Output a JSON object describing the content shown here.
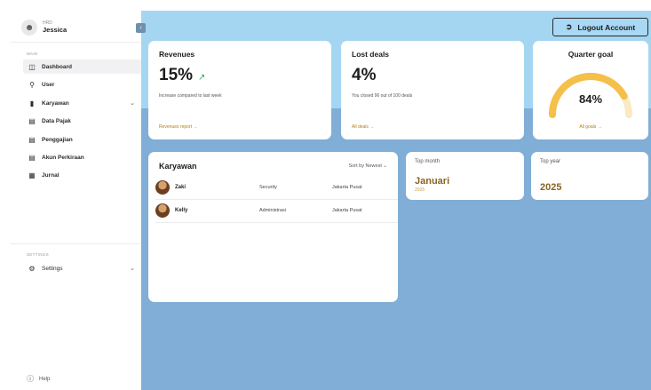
{
  "profile": {
    "role": "HRD",
    "name": "Jessica"
  },
  "sidebar": {
    "main_label": "MAIN",
    "items": [
      {
        "label": "Dashboard",
        "icon": "dashboard-icon"
      },
      {
        "label": "User",
        "icon": "user-icon"
      },
      {
        "label": "Karyawan",
        "icon": "chart-icon"
      },
      {
        "label": "Data Pajak",
        "icon": "calendar-icon"
      },
      {
        "label": "Penggajian",
        "icon": "calendar-icon"
      },
      {
        "label": "Akun Perkiraan",
        "icon": "calendar-icon"
      },
      {
        "label": "Jurnal",
        "icon": "document-icon"
      }
    ],
    "settings_label": "SETTINGS",
    "settings_item": "Settings",
    "help": "Help"
  },
  "header": {
    "logout_label": "Logout Account"
  },
  "revenues": {
    "title": "Revenues",
    "value": "15%",
    "subtitle": "Increase compared to last week",
    "link": "Revenues report →"
  },
  "lost_deals": {
    "title": "Lost deals",
    "value": "4%",
    "subtitle": "You closed 96 out of 100 deals",
    "link": "All deals →"
  },
  "quarter_goal": {
    "title": "Quarter goal",
    "value": "84%",
    "progress": 0.84,
    "link": "All goals →"
  },
  "karyawan": {
    "title": "Karyawan",
    "sort": "Sort by Newest",
    "rows": [
      {
        "name": "Zaki",
        "dept": "Security",
        "location": "Jakarta Pusat"
      },
      {
        "name": "Kelly",
        "dept": "Administrasi",
        "location": "Jakarta Pusat"
      }
    ]
  },
  "top_month": {
    "label": "Top month",
    "value": "Januari",
    "year": "2025"
  },
  "top_year": {
    "label": "Top year",
    "value": "2025"
  },
  "colors": {
    "accent": "#b07d1a",
    "gauge": "#f4c04a",
    "gauge_track": "#fbe9c3"
  }
}
